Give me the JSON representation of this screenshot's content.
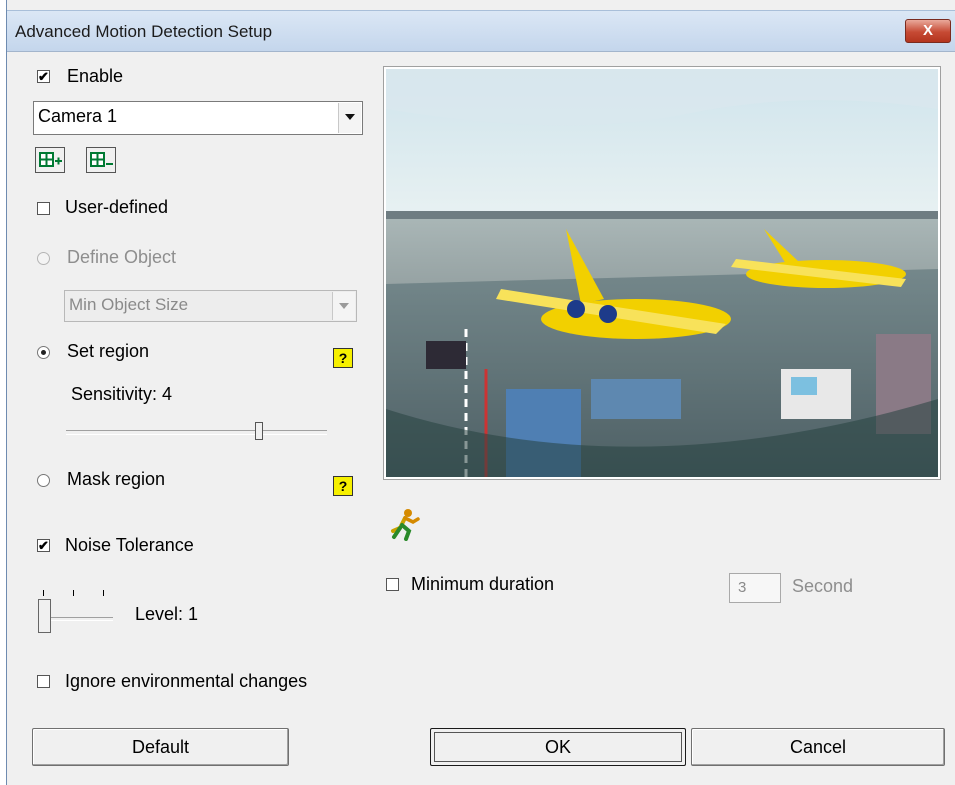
{
  "window": {
    "title": "Advanced Motion Detection Setup",
    "close_glyph": "X"
  },
  "enable": {
    "label": "Enable",
    "checked": true
  },
  "camera_select": {
    "value": "Camera 1"
  },
  "region_buttons": [
    {
      "icon": "grid-add-icon"
    },
    {
      "icon": "grid-remove-icon"
    }
  ],
  "user_defined": {
    "label": "User-defined",
    "checked": false
  },
  "define_object": {
    "label": "Define Object",
    "selected": false,
    "enabled": false
  },
  "object_size_select": {
    "value": "Min Object Size",
    "enabled": false
  },
  "set_region": {
    "label": "Set region",
    "selected": true,
    "help": "?"
  },
  "sensitivity": {
    "label": "Sensitivity: 4",
    "value": 4,
    "max": 5
  },
  "mask_region": {
    "label": "Mask region",
    "selected": false,
    "help": "?"
  },
  "noise_tolerance": {
    "label": "Noise Tolerance",
    "checked": true
  },
  "level": {
    "label": "Level: 1",
    "value": 1,
    "max": 3
  },
  "ignore_env": {
    "label": "Ignore environmental changes",
    "checked": false
  },
  "motion_icon": "running-man-icon",
  "minimum_duration": {
    "label": "Minimum duration",
    "checked": false,
    "value": "3",
    "unit": "Second"
  },
  "buttons": {
    "default": "Default",
    "ok": "OK",
    "cancel": "Cancel"
  },
  "colors": {
    "title_bar": "#c9daef",
    "close": "#c64a34",
    "help": "#f6f000",
    "plane": "#f2d000"
  }
}
